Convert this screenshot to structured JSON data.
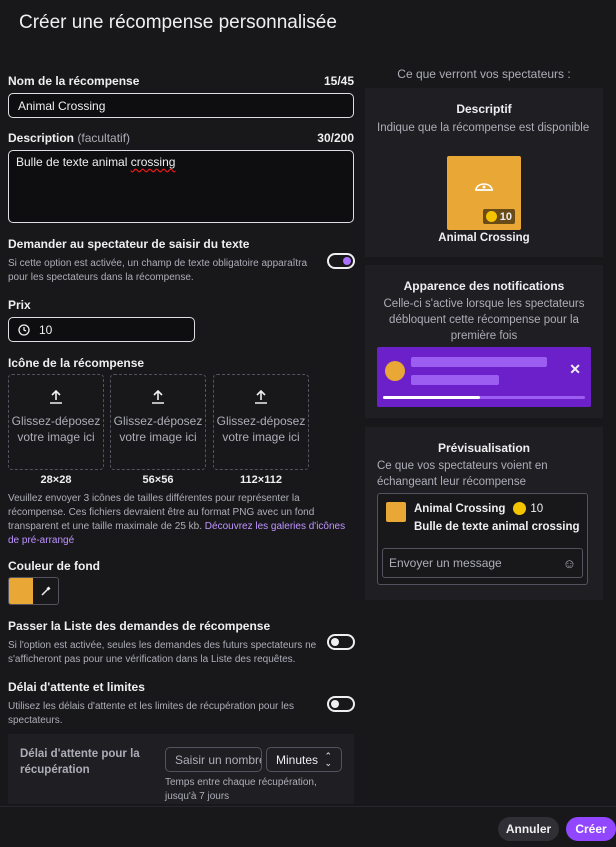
{
  "title": "Créer une récompense personnalisée",
  "name": {
    "label": "Nom de la récompense",
    "count": "15/45",
    "value": "Animal Crossing"
  },
  "description": {
    "label": "Description",
    "optional": "(facultatif)",
    "count": "30/200",
    "value_spell": "Bulle de texte animal ",
    "value_word": "crossing"
  },
  "require_text": {
    "label": "Demander au spectateur de saisir du texte",
    "help": "Si cette option est activée, un champ de texte obligatoire apparaîtra pour les spectateurs dans la récompense.",
    "on": true
  },
  "price": {
    "label": "Prix",
    "value": "10"
  },
  "icon": {
    "label": "Icône de la récompense",
    "drop_text": "Glissez-déposez votre image ici",
    "sizes": [
      "28×28",
      "56×56",
      "112×112"
    ],
    "help": "Veuillez envoyer 3 icônes de tailles différentes pour représenter la récompense. Ces fichiers devraient être au format PNG avec un fond transparent et une taille maximale de 25 kb.",
    "link": "Découvrez les galeries d'icônes de pré-arrangé"
  },
  "bg_color": {
    "label": "Couleur de fond",
    "value": "#e9a735"
  },
  "skip_queue": {
    "label": "Passer la Liste des demandes de récompense",
    "help": "Si l'option est activée, seules les demandes des futurs spectateurs ne s'afficheront pas pour une vérification dans la Liste des requêtes.",
    "on": false
  },
  "cooldown": {
    "label": "Délai d'attente et limites",
    "help": "Utilisez les délais d'attente et les limites de récupération pour les spectateurs.",
    "on": false,
    "sub_label": "Délai d'attente pour la récupération",
    "placeholder": "Saisir un nombre",
    "unit": "Minutes",
    "sub_help": "Temps entre chaque récupération, jusqu'à 7 jours"
  },
  "preview": {
    "heading": "Ce que verront vos spectateurs :",
    "descriptive": {
      "title": "Descriptif",
      "desc": "Indique que la récompense est disponible",
      "cost": "10",
      "name": "Animal Crossing"
    },
    "notifications": {
      "title": "Apparence des notifications",
      "desc": "Celle-ci s'active lorsque les spectateurs débloquent cette récompense pour la première fois",
      "progress": 0.48
    },
    "preview": {
      "title": "Prévisualisation",
      "desc": "Ce que vos spectateurs voient en échangeant leur récompense",
      "reward_name": "Animal Crossing",
      "cost": "10",
      "message": "Bulle de texte animal crossing",
      "chat_placeholder": "Envoyer un message"
    }
  },
  "footer": {
    "cancel": "Annuler",
    "create": "Créer"
  }
}
